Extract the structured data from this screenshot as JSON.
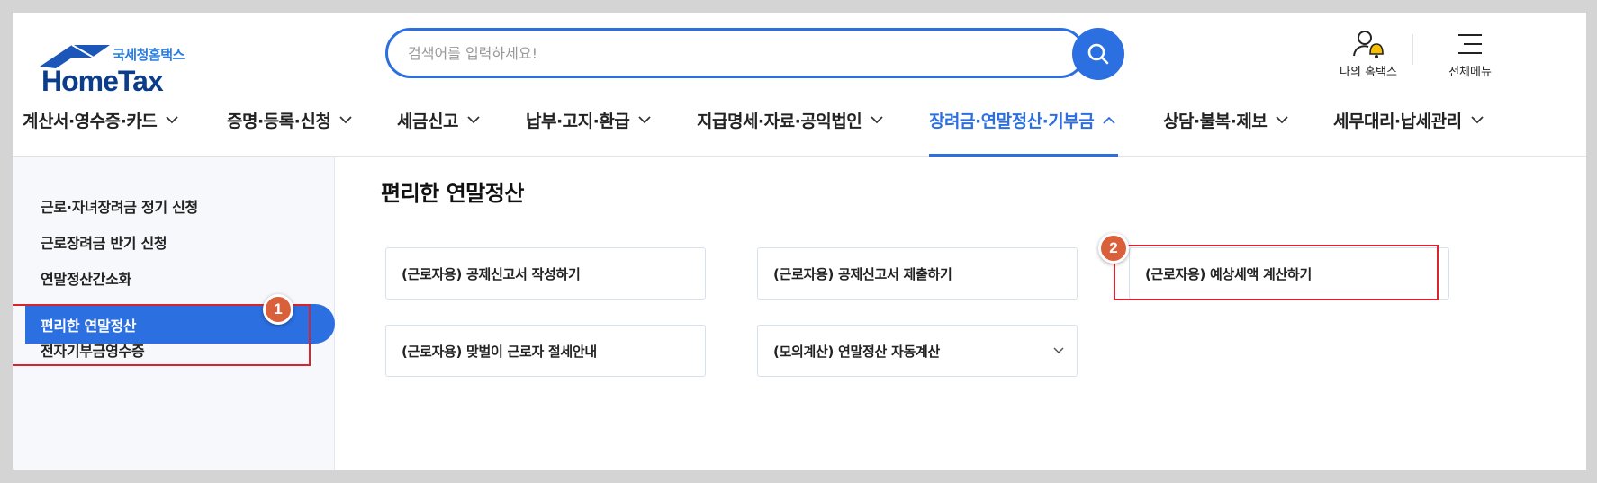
{
  "header": {
    "logo_ko": "국세청홈택스",
    "logo_en": "HomeTax",
    "search_placeholder": "검색어를 입력하세요!",
    "my_hometax": "나의 홈택스",
    "all_menu": "전체메뉴"
  },
  "gnb": [
    {
      "label": "계산서·영수증·카드",
      "active": false
    },
    {
      "label": "증명·등록·신청",
      "active": false
    },
    {
      "label": "세금신고",
      "active": false
    },
    {
      "label": "납부·고지·환급",
      "active": false
    },
    {
      "label": "지급명세·자료·공익법인",
      "active": false
    },
    {
      "label": "장려금·연말정산·기부금",
      "active": true
    },
    {
      "label": "상담·불복·제보",
      "active": false
    },
    {
      "label": "세무대리·납세관리",
      "active": false
    }
  ],
  "sidebar": {
    "items": [
      {
        "label": "근로·자녀장려금 정기 신청"
      },
      {
        "label": "근로장려금 반기 신청"
      },
      {
        "label": "연말정산간소화"
      },
      {
        "label": "편리한 연말정산"
      },
      {
        "label": "전자기부금영수증"
      }
    ],
    "active_index": 3
  },
  "main": {
    "title": "편리한 연말정산",
    "cards": [
      {
        "label": "(근로자용) 공제신고서 작성하기"
      },
      {
        "label": "(근로자용) 공제신고서 제출하기"
      },
      {
        "label": "(근로자용) 예상세액 계산하기"
      },
      {
        "label": "(근로자용) 맞벌이 근로자 절세안내"
      },
      {
        "label": "(모의계산) 연말정산 자동계산",
        "has_dropdown": true
      }
    ]
  },
  "annotations": [
    {
      "number": "1",
      "target": "편리한 연말정산"
    },
    {
      "number": "2",
      "target": "(근로자용) 예상세액 계산하기"
    }
  ],
  "colors": {
    "accent": "#2c6fe0",
    "annotation": "#d9232e",
    "badge": "#d9603a"
  },
  "icons": [
    "search-icon",
    "user-bell-icon",
    "hamburger-menu-icon",
    "chevron-down-icon",
    "chevron-up-icon"
  ]
}
